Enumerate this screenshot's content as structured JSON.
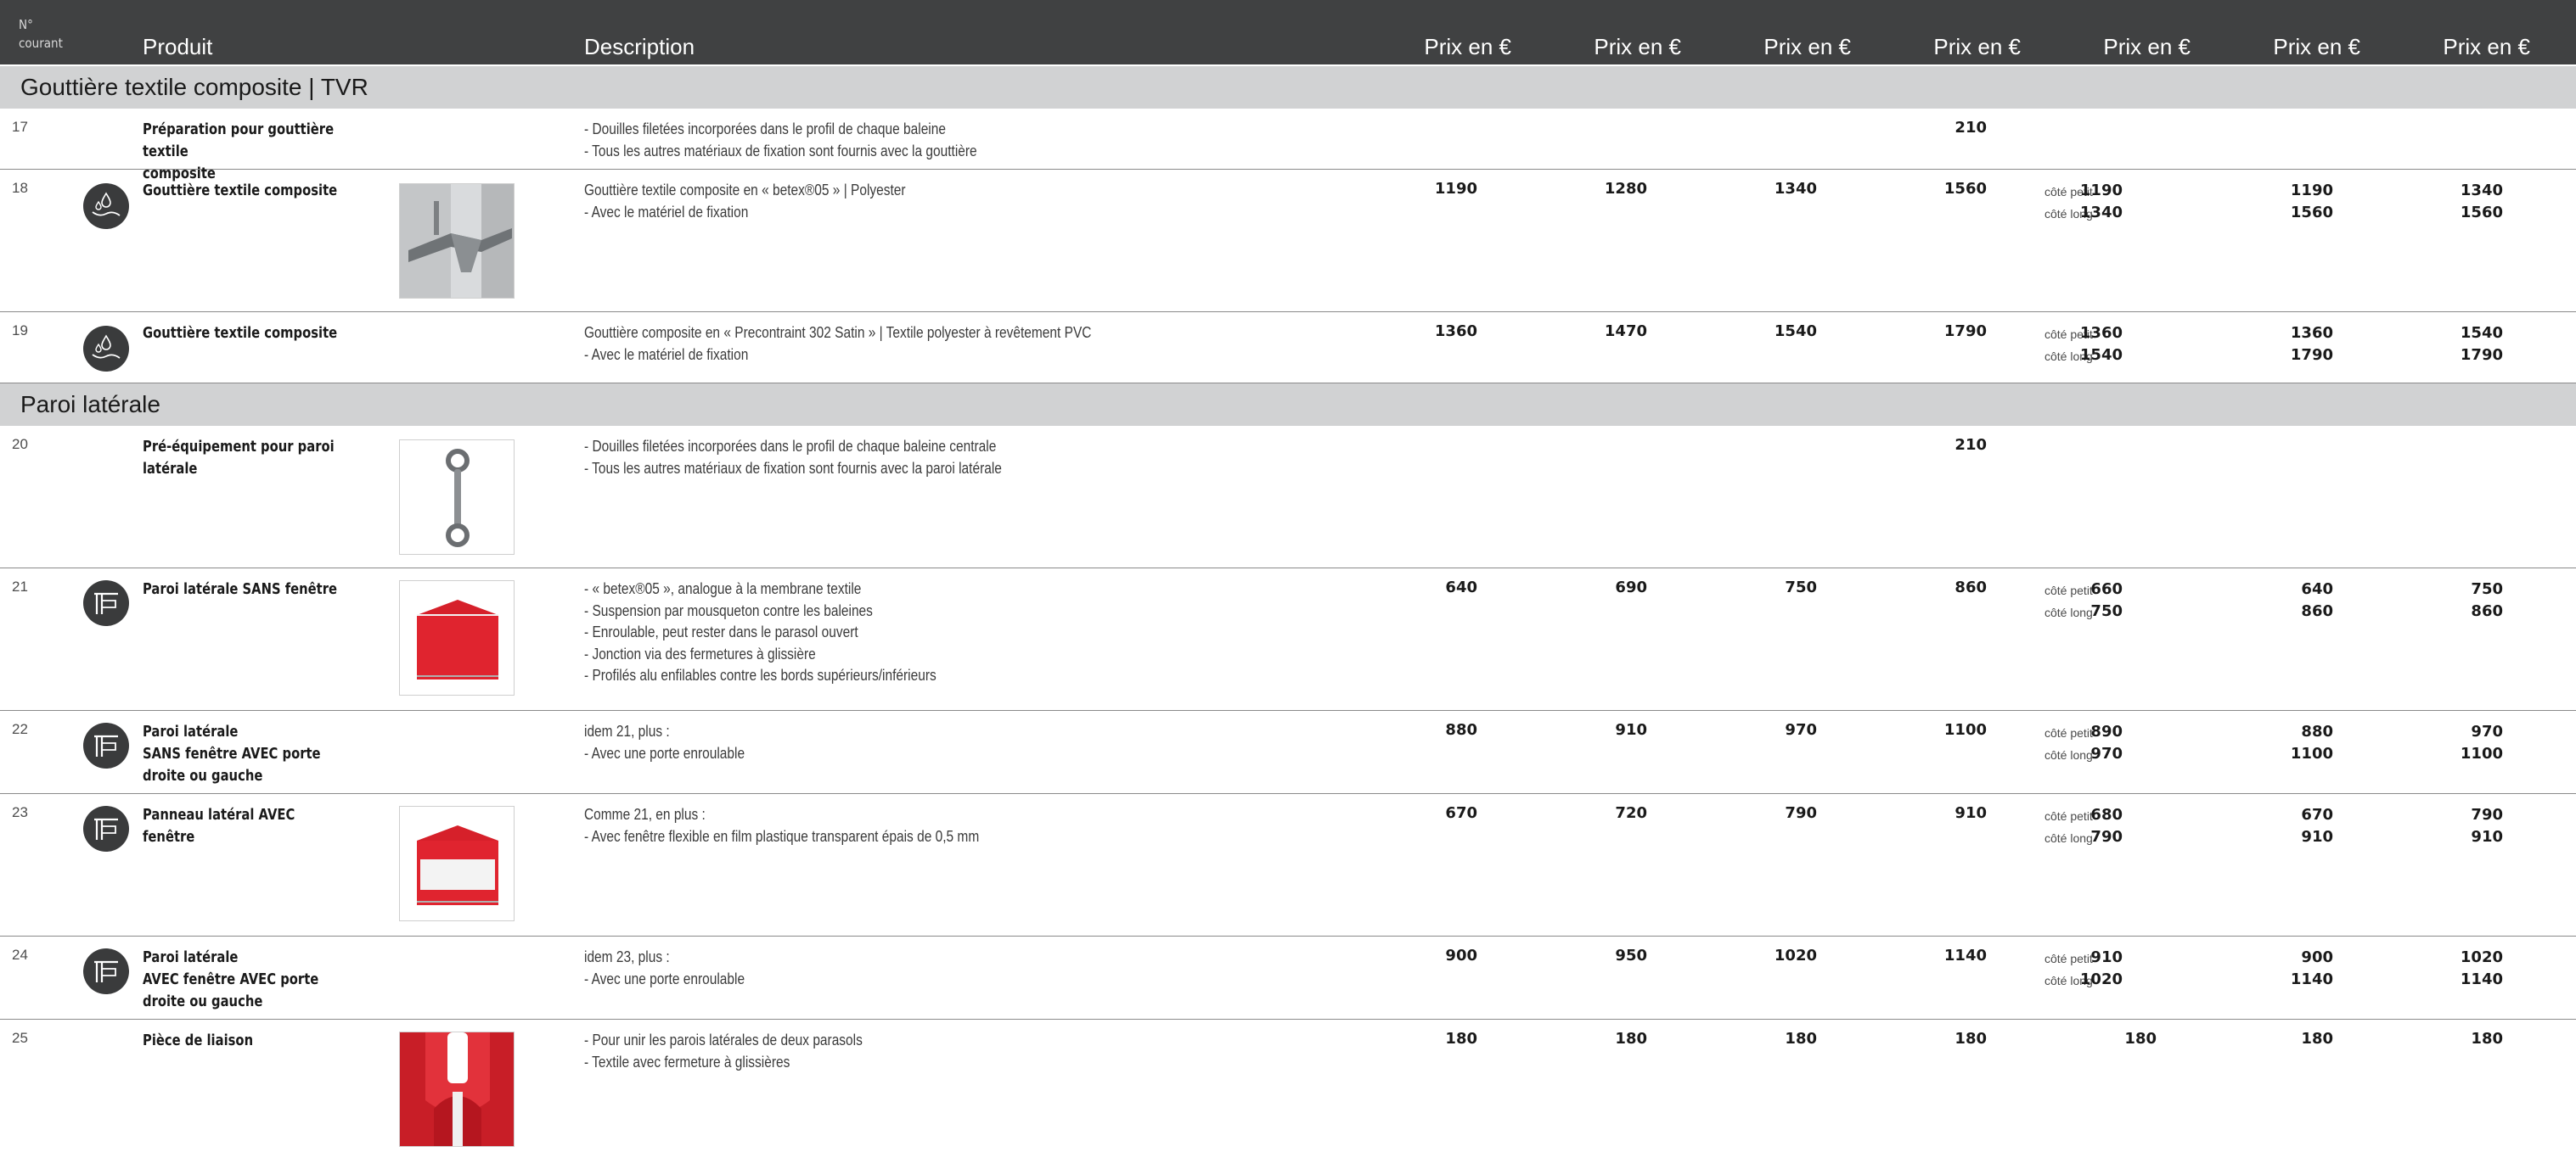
{
  "header": {
    "num_label_1": "N°",
    "num_label_2": "courant",
    "product": "Produit",
    "description": "Description",
    "price_label": "Prix en €"
  },
  "sections": [
    {
      "title": "Gouttière textile composite | TVR"
    },
    {
      "title": "Paroi latérale"
    }
  ],
  "side_labels": "côté petit\ncôté long",
  "rows": [
    {
      "num": "17",
      "name": "Préparation pour gouttière textile\ncomposite",
      "icon": "",
      "image": "",
      "desc": "- Douilles filetées incorporées dans le profil de chaque baleine\n- Tous les autres matériaux de fixation sont fournis avec la gouttière",
      "prices": [
        "",
        "",
        "",
        "210",
        "",
        "",
        ""
      ],
      "dual": false
    },
    {
      "num": "18",
      "name": "Gouttière textile composite",
      "icon": "gutter-water-icon",
      "image": "gutter-photo",
      "desc": "Gouttière textile composite en « betex®05 » | Polyester\n- Avec le matériel de fixation",
      "prices": [
        "1190",
        "1280",
        "1340",
        "1560"
      ],
      "dual": true,
      "p5": "1190\n1340",
      "p6": "1190\n1560",
      "p7": "1340\n1560"
    },
    {
      "num": "19",
      "name": "Gouttière textile composite",
      "icon": "gutter-water-icon",
      "image": "",
      "desc": "Gouttière composite en « Precontraint 302 Satin » | Textile polyester à revêtement PVC\n- Avec le matériel de fixation",
      "prices": [
        "1360",
        "1470",
        "1540",
        "1790"
      ],
      "dual": true,
      "p5": "1360\n1540",
      "p6": "1360\n1790",
      "p7": "1540\n1790"
    },
    {
      "num": "20",
      "name": "Pré-équipement pour paroi latérale",
      "icon": "",
      "image": "swivel-hook-photo",
      "desc": "- Douilles filetées incorporées dans le profil de chaque baleine centrale\n- Tous les autres matériaux de fixation sont fournis avec la paroi latérale",
      "prices": [
        "",
        "",
        "",
        "210",
        "",
        "",
        ""
      ],
      "dual": false
    },
    {
      "num": "21",
      "name": "Paroi latérale SANS fenêtre",
      "icon": "side-wall-icon",
      "image": "red-wall-photo",
      "desc": "- « betex®05 », analogue à la membrane textile\n- Suspension par mousqueton contre les baleines\n- Enroulable, peut rester dans le parasol ouvert\n- Jonction via des fermetures à glissière\n- Profilés alu enfilables contre les bords supérieurs/inférieurs",
      "prices": [
        "640",
        "690",
        "750",
        "860"
      ],
      "dual": true,
      "p5": "660\n750",
      "p6": "640\n860",
      "p7": "750\n860"
    },
    {
      "num": "22",
      "name": "Paroi latérale\nSANS fenêtre AVEC porte\ndroite ou gauche",
      "icon": "side-wall-icon",
      "image": "",
      "desc": "idem 21, plus :\n- Avec une porte enroulable",
      "prices": [
        "880",
        "910",
        "970",
        "1100"
      ],
      "dual": true,
      "p5": "890\n970",
      "p6": "880\n1100",
      "p7": "970\n1100"
    },
    {
      "num": "23",
      "name": "Panneau latéral AVEC fenêtre",
      "icon": "side-wall-icon",
      "image": "window-wall-photo",
      "desc": "Comme 21, en plus :\n- Avec fenêtre flexible en film plastique transparent épais de 0,5 mm",
      "prices": [
        "670",
        "720",
        "790",
        "910"
      ],
      "dual": true,
      "p5": "680\n790",
      "p6": "670\n910",
      "p7": "790\n910"
    },
    {
      "num": "24",
      "name": "Paroi latérale\nAVEC fenêtre AVEC porte\ndroite ou gauche",
      "icon": "side-wall-icon",
      "image": "",
      "desc": "idem 23, plus :\n- Avec une porte enroulable",
      "prices": [
        "900",
        "950",
        "1020",
        "1140"
      ],
      "dual": true,
      "p5": "910\n1020",
      "p6": "900\n1140",
      "p7": "1020\n1140"
    },
    {
      "num": "25",
      "name": "Pièce de liaison",
      "icon": "",
      "image": "connector-photo",
      "desc": "- Pour unir les parois latérales de deux parasols\n- Textile avec fermeture à glissières",
      "prices": [
        "180",
        "180",
        "180",
        "180",
        "180",
        "180",
        "180"
      ],
      "dual": false
    }
  ]
}
